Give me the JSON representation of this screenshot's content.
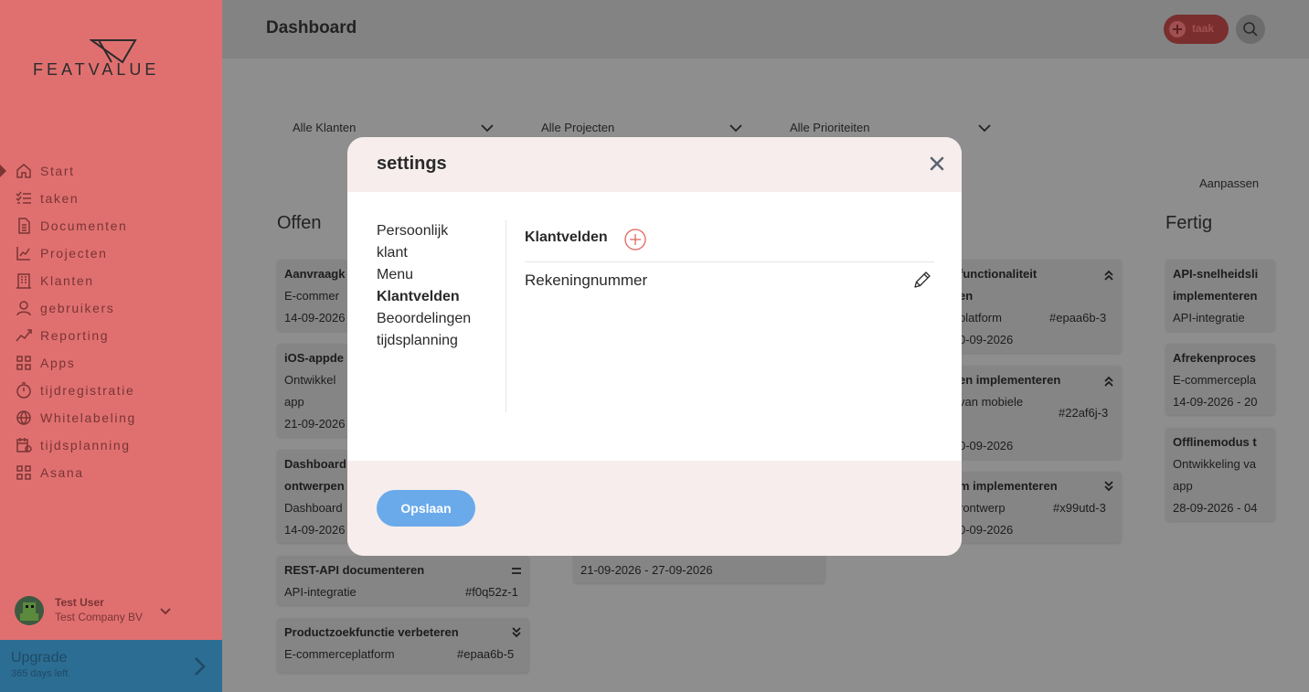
{
  "brand": {
    "name": "FEATVALUE"
  },
  "sidebar": {
    "items": [
      {
        "label": "Start",
        "icon": "home-icon"
      },
      {
        "label": "taken",
        "icon": "checklist-icon"
      },
      {
        "label": "Documenten",
        "icon": "document-icon"
      },
      {
        "label": "Projecten",
        "icon": "chart-icon"
      },
      {
        "label": "Klanten",
        "icon": "building-icon"
      },
      {
        "label": "gebruikers",
        "icon": "user-icon"
      },
      {
        "label": "Reporting",
        "icon": "graph-icon"
      },
      {
        "label": "Apps",
        "icon": "grid-icon"
      },
      {
        "label": "tijdregistratie",
        "icon": "timer-icon"
      },
      {
        "label": "Whitelabeling",
        "icon": "globe-icon"
      },
      {
        "label": "tijdsplanning",
        "icon": "calendar-icon"
      },
      {
        "label": "Asana",
        "icon": "grid-icon"
      }
    ],
    "user": {
      "name": "Test User",
      "company": "Test Company BV"
    },
    "upgrade": {
      "title": "Upgrade",
      "subtitle": "365 days left"
    }
  },
  "header": {
    "title": "Dashboard",
    "task_button": "taak"
  },
  "filters": [
    "Alle Klanten",
    "Alle Projecten",
    "Alle Prioriteiten"
  ],
  "aanpassen": "Aanpassen",
  "board": {
    "columns": [
      {
        "title": "Offen"
      },
      {
        "title": "Fertig"
      }
    ],
    "col1": [
      {
        "title": "Aanvraagk",
        "line1": "E-commer",
        "line2": "14-09-2026"
      },
      {
        "title": "iOS-appde",
        "line1": "Ontwikkel",
        "line2": "app",
        "line3": "21-09-2026"
      },
      {
        "title": "Dashboard",
        "title2": "ontwerpen",
        "line1": "Dashboard",
        "line2": "14-09-2026"
      },
      {
        "title": "REST-API documenteren",
        "line1": "API-integratie",
        "id": "#f0q52z-1"
      },
      {
        "title": "Productzoekfunctie verbeteren",
        "line1": "E-commerceplatform",
        "id": "#epaa6b-5"
      }
    ],
    "col2_date": "21-09-2026 - 27-09-2026",
    "col3": [
      {
        "title": "functionaliteit",
        "title2": "en",
        "line1": "platform",
        "id": "#epaa6b-3",
        "line2": "0-09-2026"
      },
      {
        "title": "en implementeren",
        "line1": "van mobiele",
        "id": "#22af6j-3",
        "line2": "0-09-2026"
      },
      {
        "title": "m implementeren",
        "line1": "rontwerp",
        "id": "#x99utd-3",
        "line2": "0-09-2026"
      }
    ],
    "col4": [
      {
        "title": "API-snelheidsli",
        "title2": "implementeren",
        "line1": "API-integratie"
      },
      {
        "title": "Afrekenproces",
        "line1": "E-commercepla",
        "line2": "14-09-2026 - 20"
      },
      {
        "title": "Offlinemodus t",
        "line1": "Ontwikkeling va",
        "line2": "app",
        "line3": "28-09-2026 - 04"
      }
    ]
  },
  "modal": {
    "title": "settings",
    "nav": [
      "Persoonlijk",
      "klant",
      "Menu",
      "Klantvelden",
      "Beoordelingen",
      "tijdsplanning"
    ],
    "section_title": "Klantvelden",
    "fields": [
      "Rekeningnummer"
    ],
    "save_label": "Opslaan"
  }
}
